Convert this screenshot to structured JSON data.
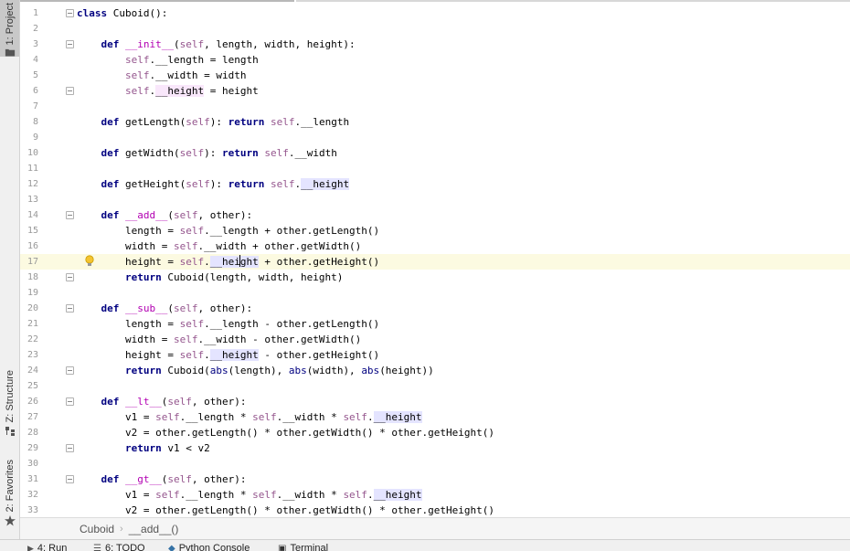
{
  "left_strip": {
    "project_tab": "1: Project",
    "structure_tab": "Z: Structure",
    "favorites_tab": "2: Favorites"
  },
  "lines": [
    {
      "n": "1",
      "text": "class Cuboid():"
    },
    {
      "n": "2",
      "text": ""
    },
    {
      "n": "3",
      "text": "    def __init__(self, length, width, height):"
    },
    {
      "n": "4",
      "text": "        self.__length = length"
    },
    {
      "n": "5",
      "text": "        self.__width = width"
    },
    {
      "n": "6",
      "text": "        self.__height = height"
    },
    {
      "n": "7",
      "text": ""
    },
    {
      "n": "8",
      "text": "    def getLength(self): return self.__length"
    },
    {
      "n": "9",
      "text": ""
    },
    {
      "n": "10",
      "text": "    def getWidth(self): return self.__width"
    },
    {
      "n": "11",
      "text": ""
    },
    {
      "n": "12",
      "text": "    def getHeight(self): return self.__height"
    },
    {
      "n": "13",
      "text": ""
    },
    {
      "n": "14",
      "text": "    def __add__(self, other):"
    },
    {
      "n": "15",
      "text": "        length = self.__length + other.getLength()"
    },
    {
      "n": "16",
      "text": "        width = self.__width + other.getWidth()"
    },
    {
      "n": "17",
      "text": "        height = self.__height + other.getHeight()"
    },
    {
      "n": "18",
      "text": "        return Cuboid(length, width, height)"
    },
    {
      "n": "19",
      "text": ""
    },
    {
      "n": "20",
      "text": "    def __sub__(self, other):"
    },
    {
      "n": "21",
      "text": "        length = self.__length - other.getLength()"
    },
    {
      "n": "22",
      "text": "        width = self.__width - other.getWidth()"
    },
    {
      "n": "23",
      "text": "        height = self.__height - other.getHeight()"
    },
    {
      "n": "24",
      "text": "        return Cuboid(abs(length), abs(width), abs(height))"
    },
    {
      "n": "25",
      "text": ""
    },
    {
      "n": "26",
      "text": "    def __lt__(self, other):"
    },
    {
      "n": "27",
      "text": "        v1 = self.__length * self.__width * self.__height"
    },
    {
      "n": "28",
      "text": "        v2 = other.getLength() * other.getWidth() * other.getHeight()"
    },
    {
      "n": "29",
      "text": "        return v1 < v2"
    },
    {
      "n": "30",
      "text": ""
    },
    {
      "n": "31",
      "text": "    def __gt__(self, other):"
    },
    {
      "n": "32",
      "text": "        v1 = self.__length * self.__width * self.__height"
    },
    {
      "n": "33",
      "text": "        v2 = other.getLength() * other.getWidth() * other.getHeight()"
    }
  ],
  "current_line": "17",
  "breadcrumb": {
    "class_name": "Cuboid",
    "method_name": "__add__()"
  },
  "bottom_tabs": {
    "run": "4: Run",
    "todo": "6: TODO",
    "python_console": "Python Console",
    "terminal": "Terminal"
  },
  "colors": {
    "keyword": "#000080",
    "self": "#94558d",
    "magic": "#b200b2",
    "highlight": "#e4e4ff",
    "current_line": "#fcfae1"
  }
}
